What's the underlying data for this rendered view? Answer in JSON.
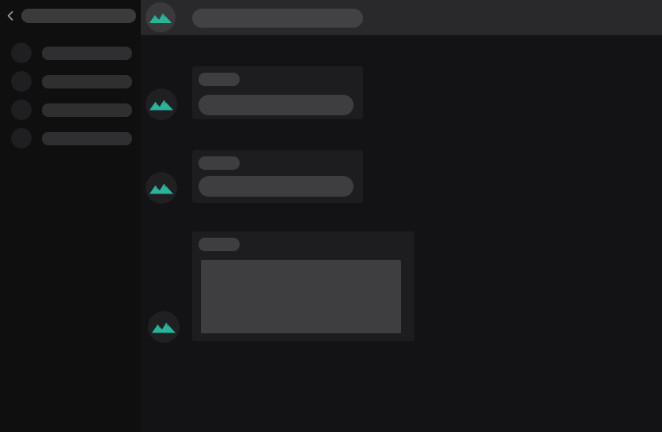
{
  "theme": {
    "accent": "#2bb39a",
    "accent_dark": "#1e7f6d",
    "background": "#131315",
    "sidebar_bg": "#0f0f10",
    "header_bg": "#29292b",
    "skeleton": "#3e3e41"
  },
  "icons": {
    "back": "chevron-left-icon",
    "avatar": "mountain-logo-icon"
  },
  "state": "loading-skeleton",
  "sidebar": {
    "item_count": 4
  },
  "messages": [
    {
      "type": "text"
    },
    {
      "type": "text"
    },
    {
      "type": "media"
    }
  ]
}
